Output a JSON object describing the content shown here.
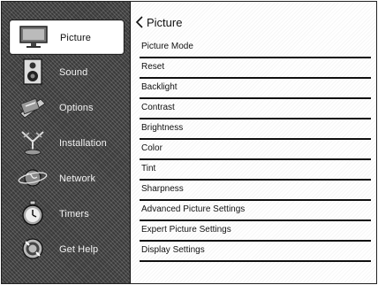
{
  "sidebar": {
    "items": [
      {
        "label": "Picture",
        "icon": "monitor-icon",
        "selected": true
      },
      {
        "label": "Sound",
        "icon": "speaker-icon",
        "selected": false
      },
      {
        "label": "Options",
        "icon": "options-icon",
        "selected": false
      },
      {
        "label": "Installation",
        "icon": "antenna-icon",
        "selected": false
      },
      {
        "label": "Network",
        "icon": "globe-icon",
        "selected": false
      },
      {
        "label": "Timers",
        "icon": "stopwatch-icon",
        "selected": false
      },
      {
        "label": "Get Help",
        "icon": "help-icon",
        "selected": false
      }
    ]
  },
  "main": {
    "title": "Picture",
    "back_icon": "chevron-left-icon",
    "menu": [
      {
        "label": "Picture Mode"
      },
      {
        "label": "Reset"
      },
      {
        "label": "Backlight"
      },
      {
        "label": "Contrast"
      },
      {
        "label": "Brightness"
      },
      {
        "label": "Color"
      },
      {
        "label": "Tint"
      },
      {
        "label": "Sharpness"
      },
      {
        "label": "Advanced Picture Settings"
      },
      {
        "label": "Expert Picture Settings"
      },
      {
        "label": "Display Settings"
      }
    ]
  }
}
